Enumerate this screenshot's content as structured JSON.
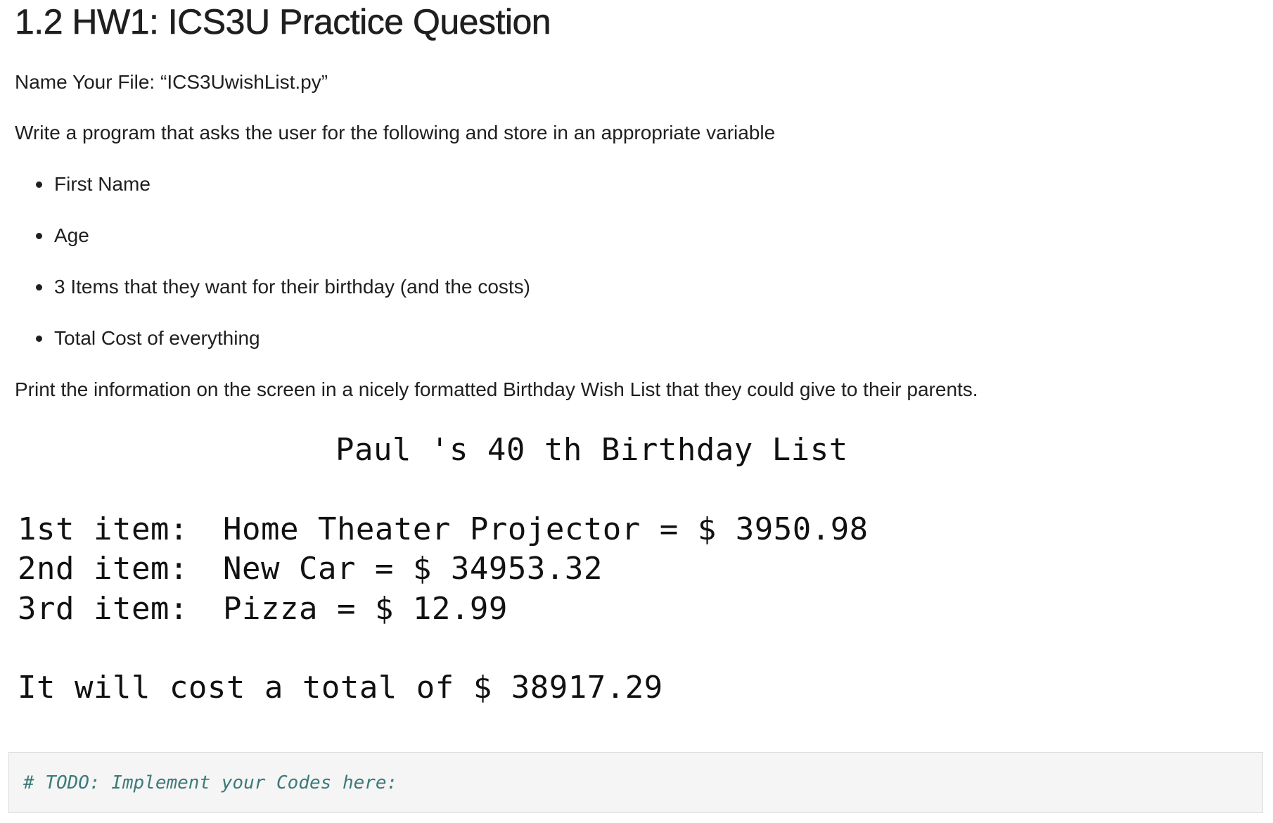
{
  "title": "1.2 HW1: ICS3U Practice Question",
  "file_instruction": "Name Your File: “ICS3UwishList.py”",
  "intro": "Write a program that asks the user for the following and store in an appropriate variable",
  "bullets": [
    "First Name",
    "Age",
    "3 Items that they want for their birthday (and the costs)",
    "Total Cost of everything"
  ],
  "print_instruction": "Print the information on the screen in a nicely formatted Birthday Wish List that they could give to their parents.",
  "sample_output": {
    "heading": "Paul 's 40 th Birthday List",
    "items": [
      {
        "label": "1st item:",
        "value": "Home Theater Projector = $ 3950.98"
      },
      {
        "label": "2nd item:",
        "value": "New Car = $ 34953.32"
      },
      {
        "label": "3rd item:",
        "value": "Pizza = $ 12.99"
      }
    ],
    "total": "It will cost a total of $ 38917.29"
  },
  "code_cell": {
    "comment": "# TODO: Implement your Codes here:"
  }
}
